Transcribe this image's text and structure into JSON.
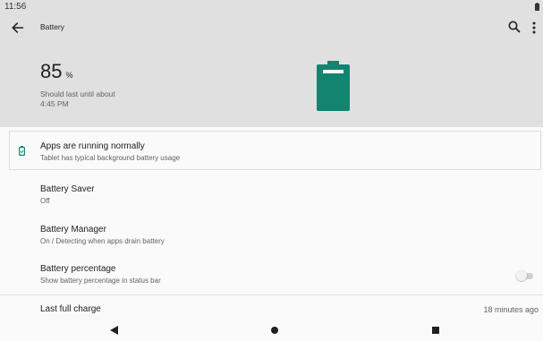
{
  "status_bar": {
    "time": "11:56",
    "icons": [
      "battery-icon"
    ]
  },
  "app_bar": {
    "title": "Battery",
    "icons": [
      "back-arrow-icon",
      "search-icon",
      "more-vert-icon"
    ]
  },
  "summary": {
    "level": "85",
    "unit": "%",
    "estimate_line1": "Should last until about",
    "estimate_line2": "4:45 PM",
    "battery_fill_fraction": 0.85,
    "battery_color": "#128470"
  },
  "tip": {
    "title": "Apps are running normally",
    "subtitle": "Tablet has typical background battery usage",
    "icon": "battery-outline-icon",
    "icon_color": "#128470"
  },
  "settings": [
    {
      "title": "Battery Saver",
      "subtitle": "Off"
    },
    {
      "title": "Battery Manager",
      "subtitle": "On / Detecting when apps drain battery"
    },
    {
      "title": "Battery percentage",
      "subtitle": "Show battery percentage in status bar",
      "toggle_on": false
    }
  ],
  "last_charge": {
    "label": "Last full charge",
    "value": "18 minutes ago"
  },
  "nav_bar": {
    "icons": [
      "nav-back-icon",
      "nav-home-icon",
      "nav-recents-icon"
    ]
  }
}
